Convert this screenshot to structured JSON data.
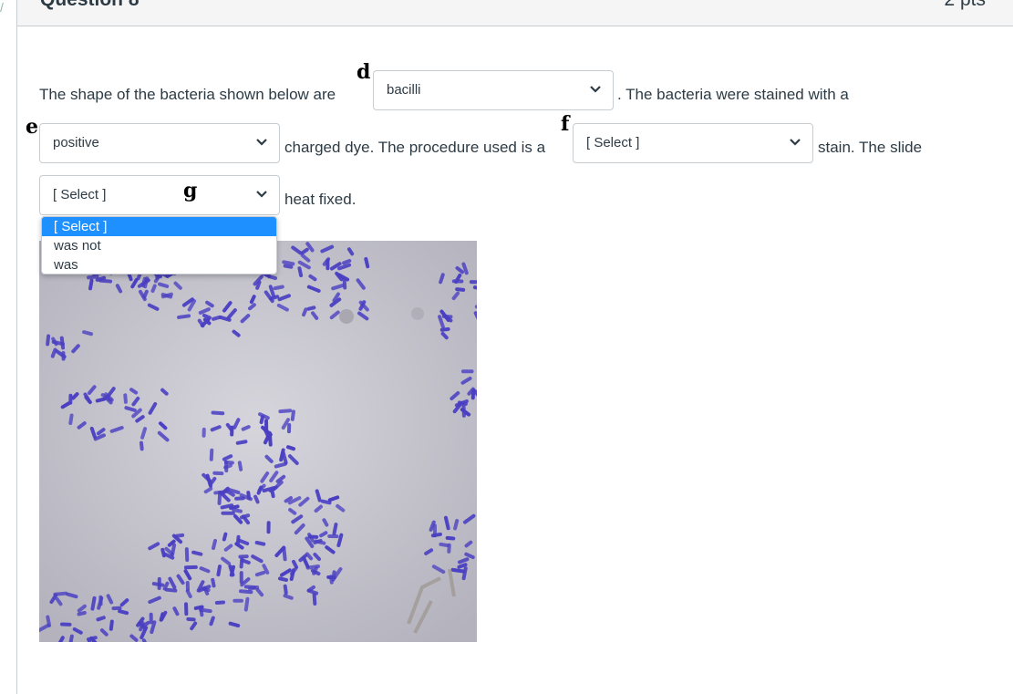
{
  "header": {
    "title": "Question 8",
    "points": "2 pts"
  },
  "question": {
    "line1_a": "The shape of the bacteria shown below are",
    "line1_b": ". The bacteria were stained with a",
    "line2_a": "charged dye. The procedure used is a",
    "line2_b": "stain. The slide",
    "line3": "heat fixed."
  },
  "dropdowns": {
    "shape": {
      "value": "bacilli"
    },
    "charge": {
      "value": "positive"
    },
    "procedure": {
      "value": "[ Select ]"
    },
    "heat_fixed": {
      "value": "[ Select ]",
      "options": [
        "[ Select ]",
        "was not",
        "was"
      ],
      "selected_index": 0
    }
  },
  "annotations": {
    "d": "d",
    "e": "e",
    "f": "f",
    "g": "g"
  },
  "image": {
    "subject": "gram-stained-bacilli-micrograph",
    "stain_color": "#4a3fc2",
    "background_color": "#c4c3cd"
  },
  "colors": {
    "highlight": "#1e90ff",
    "text": "#2d3b45",
    "border": "#c7cdd1"
  }
}
